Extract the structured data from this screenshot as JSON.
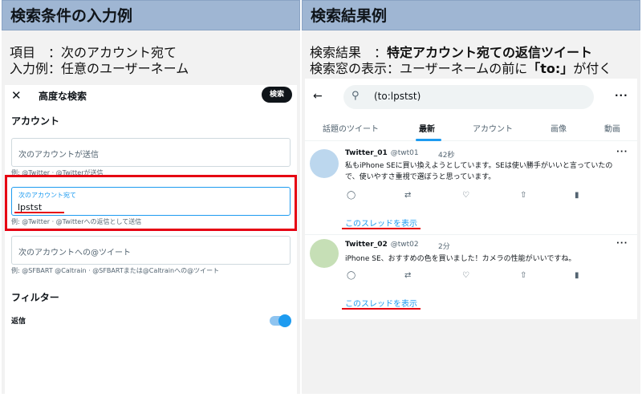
{
  "left": {
    "banner": "検索条件の入力例",
    "caption_line1": "項目　：次のアカウント宛て",
    "caption_line2": "入力例：任意のユーザーネーム",
    "app": {
      "title": "高度な検索",
      "close_icon": "close-icon",
      "search_button": "検索",
      "account_section": "アカウント",
      "field_from": {
        "label": "次のアカウントが送信",
        "hint": "例: @Twitter · @Twitterが送信"
      },
      "field_to": {
        "label": "次のアカウント宛て",
        "value": "lpstst",
        "hint": "例: @Twitter · @Twitterへの返信として送信"
      },
      "field_mention": {
        "label": "次のアカウントへの@ツイート",
        "hint": "例: @SFBART @Caltrain · @SFBARTまたは@Caltrainへの@ツイート"
      },
      "filter_section": "フィルター",
      "reply_toggle_label": "返信",
      "reply_toggle_on": true
    }
  },
  "right": {
    "banner": "検索結果例",
    "caption1_label": "検索結果　：",
    "caption1_value": "特定アカウント宛ての返信ツイート",
    "caption2_label": "検索窓の表示：ユーザーネームの前に",
    "caption2_value": "「to:」",
    "caption2_suffix": "が付く",
    "app": {
      "back_icon": "back-arrow-icon",
      "search_query": "(to:lpstst)",
      "more_icon": "more-dots-icon",
      "tabs": [
        {
          "label": "話題のツイート",
          "active": false
        },
        {
          "label": "最新",
          "active": true
        },
        {
          "label": "アカウント",
          "active": false
        },
        {
          "label": "画像",
          "active": false
        },
        {
          "label": "動画",
          "active": false
        }
      ],
      "tweets": [
        {
          "name": "Twitter_01",
          "handle": "@twt01",
          "time": "42秒",
          "text": "私もiPhone SEに買い換えようとしています。SEは使い勝手がいいと言っていたので、使いやすさ重視で選ぼうと思っています。",
          "thread_link": "このスレッドを表示",
          "avatar_color": "#bcd7ee"
        },
        {
          "name": "Twitter_02",
          "handle": "@twt02",
          "time": "2分",
          "text": "iPhone SE、おすすめの色を買いました！カメラの性能がいいですね。",
          "thread_link": "このスレッドを表示",
          "avatar_color": "#c6dfb6"
        }
      ]
    }
  },
  "colors": {
    "banner": "#9fb6d3",
    "accent": "#1d9bf0",
    "highlight": "#e60012"
  }
}
